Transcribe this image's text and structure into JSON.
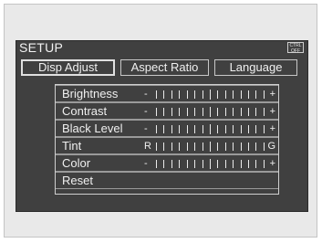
{
  "screen_title": "SETUP",
  "badge_text": "CTRL OFF",
  "tabs": [
    {
      "label": "Disp Adjust",
      "active": true
    },
    {
      "label": "Aspect Ratio",
      "active": false
    },
    {
      "label": "Language",
      "active": false
    }
  ],
  "settings": [
    {
      "label": "Brightness",
      "left": "-",
      "right": "+"
    },
    {
      "label": "Contrast",
      "left": "-",
      "right": "+"
    },
    {
      "label": "Black Level",
      "left": "-",
      "right": "+"
    },
    {
      "label": "Tint",
      "left": "R",
      "right": "G"
    },
    {
      "label": "Color",
      "left": "-",
      "right": "+"
    }
  ],
  "reset_label": "Reset"
}
